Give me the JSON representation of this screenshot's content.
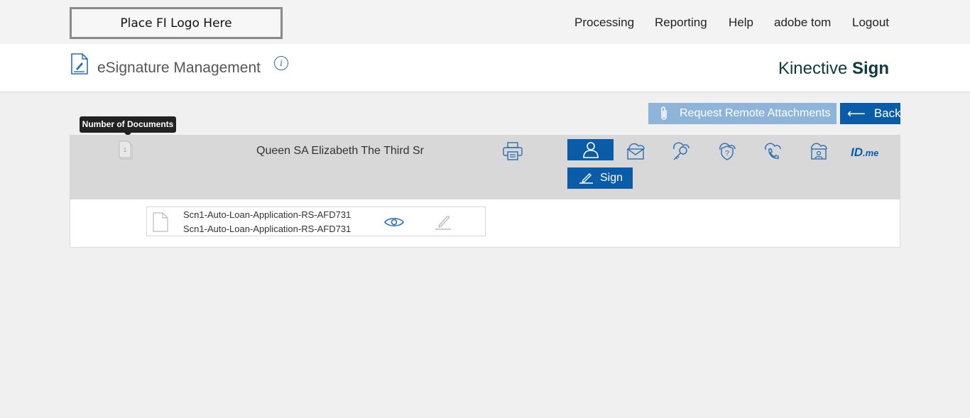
{
  "topbar": {
    "logo_text": "Place FI Logo Here",
    "nav": {
      "processing": "Processing",
      "reporting": "Reporting",
      "help": "Help",
      "user": "adobe tom",
      "logout": "Logout"
    }
  },
  "header": {
    "title": "eSignature Management",
    "info_icon": "i",
    "brand_light": "Kinective ",
    "brand_bold": "Sign"
  },
  "actions": {
    "request_remote_attachments": "Request Remote Attachments",
    "back_arrow": "⟵",
    "back": "Back"
  },
  "tooltip": {
    "text": "Number of Documents"
  },
  "signer": {
    "doc_count": "1",
    "name": "Queen SA Elizabeth The Third Sr",
    "auth_methods": [
      "person-icon",
      "email-icon",
      "key-icon",
      "security-question-icon",
      "phone-icon",
      "id-card-icon",
      "idme-logo"
    ],
    "idme_prefix": "ID",
    "idme_suffix": ".me",
    "sign_label": "Sign"
  },
  "documents": [
    {
      "name_line1": "Scn1-Auto-Loan-Application-RS-AFD731",
      "name_line2": "Scn1-Auto-Loan-Application-RS-AFD731"
    }
  ],
  "colors": {
    "primary": "#0a5ca8",
    "primary_disabled": "#8fb4d9",
    "brand": "#0f3b3f",
    "row_bg": "#d8d8d8",
    "page_bg": "#f0f0f0"
  }
}
